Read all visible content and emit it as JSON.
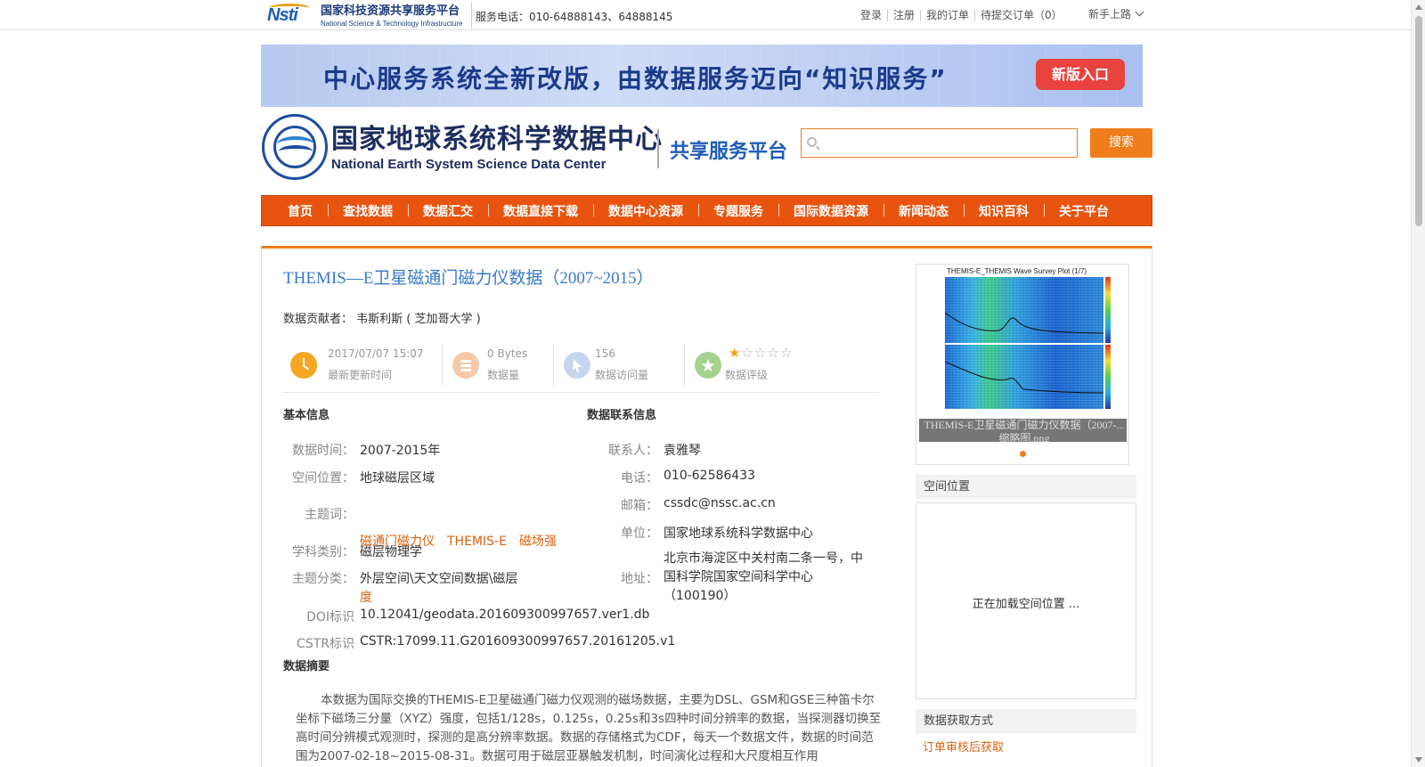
{
  "topbar": {
    "logo_cn": "国家科技资源共享服务平台",
    "logo_en": "National Science & Technology Infrastructure",
    "logo_mark": "Nsti",
    "hotline": "服务电话：010-64888143、64888145",
    "links": [
      "登录",
      "注册",
      "我的订单",
      "待提交订单（0）"
    ],
    "guide": "新手上路"
  },
  "banner": {
    "text": "中心服务系统全新改版，由数据服务迈向“知识服务”",
    "button": "新版入口"
  },
  "header": {
    "center_cn": "国家地球系统科学数据中心",
    "center_en": "National Earth System Science Data Center",
    "platform": "共享服务平台",
    "search_placeholder": "",
    "search_button": "搜索"
  },
  "nav": [
    "首页",
    "查找数据",
    "数据汇交",
    "数据直接下载",
    "数据中心资源",
    "专题服务",
    "国际数据资源",
    "新闻动态",
    "知识百科",
    "关于平台"
  ],
  "dataset": {
    "title": "THEMIS—E卫星磁通门磁力仪数据（2007~2015）",
    "contributor_label": "数据贡献者：",
    "contributor": "韦斯利斯 ( 芝加哥大学 )",
    "stats": [
      {
        "value": "2017/07/07 15:07",
        "label": "最新更新时间",
        "icon": "clock-icon",
        "color": "#f5a623"
      },
      {
        "value": "0 Bytes",
        "label": "数据量",
        "icon": "database-icon",
        "color": "#f6c9a8"
      },
      {
        "value": "156",
        "label": "数据访问量",
        "icon": "cursor-icon",
        "color": "#c5d6ee"
      },
      {
        "value": "",
        "label": "数据评级",
        "icon": "star-badge-icon",
        "color": "#a6d18f"
      }
    ],
    "rating": 1,
    "rating_max": 5
  },
  "basic_info": {
    "heading": "基本信息",
    "time_label": "数据时间：",
    "time": "2007-2015年",
    "space_label": "空间位置：",
    "space": "地球磁层区域",
    "keywords_label": "主题词：",
    "keywords_line1": "磁通门磁力仪　THEMIS-E　磁场强",
    "keywords_line2": "度",
    "discipline_label": "学科类别：",
    "discipline": "磁层物理学",
    "category_label": "主题分类：",
    "category": "外层空间\\天文空间数据\\磁层",
    "doi_label": "DOI标识",
    "doi": "10.12041/geodata.201609300997657.ver1.db",
    "cstr_label": "CSTR标识",
    "cstr": "CSTR:17099.11.G201609300997657.20161205.v1"
  },
  "contact_info": {
    "heading": "数据联系信息",
    "person_label": "联系人：",
    "person": "袁雅琴",
    "phone_label": "电话：",
    "phone": "010-62586433",
    "email_label": "邮箱：",
    "email": "cssdc@nssc.ac.cn",
    "unit_label": "单位：",
    "unit": "国家地球系统科学数据中心",
    "address_label": "地址：",
    "address_line1": "北京市海淀区中关村南二条一号，中",
    "address_line2": "国科学院国家空间科学中心",
    "address_line3": "（100190）"
  },
  "abstract": {
    "heading": "数据摘要",
    "text": "本数据为国际交换的THEMIS-E卫星磁通门磁力仪观测的磁场数据，主要为DSL、GSM和GSE三种笛卡尔坐标下磁场三分量（XYZ）强度，包括1/128s，0.125s，0.25s和3s四种时间分辨率的数据，当探测器切换至高时间分辨模式观测时，探测的是高分辨率数据。数据的存储格式为CDF，每天一个数据文件，数据的时间范围为2007-02-18~2015-08-31。数据可用于磁层亚暴触发机制，时间演化过程和大尺度相互作用"
  },
  "sidebar": {
    "thumb_header": "THEMIS-E_THEMIS Wave Survey Plot (1/7)",
    "thumb_caption": "THEMIS-E卫星磁通门磁力仪数据（2007-...缩略图.png",
    "spatial_heading": "空间位置",
    "spatial_loading": "正在加载空间位置 ...",
    "access_heading": "数据获取方式",
    "access_link": "订单审核后获取"
  }
}
